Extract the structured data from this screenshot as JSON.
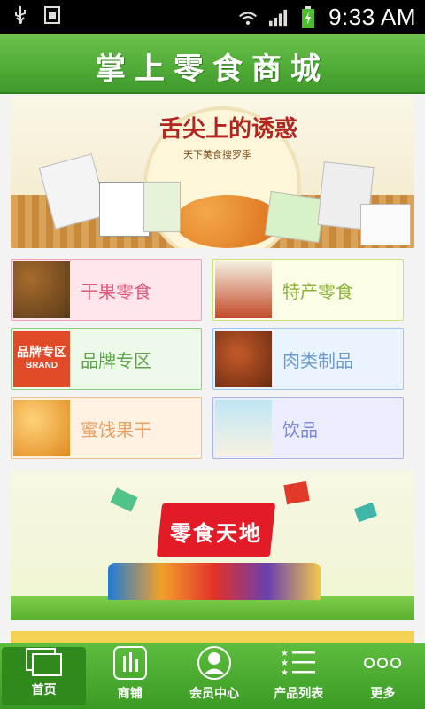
{
  "status_bar": {
    "time": "9:33 AM"
  },
  "header": {
    "title": "掌上零食商城"
  },
  "banner_top": {
    "headline": "舌尖上的诱惑",
    "subline": "天下美食搜罗季"
  },
  "categories": [
    {
      "label": "干果零食",
      "text_color": "#e05a7a",
      "bg": "#ffe6ec",
      "border": "#f2a0b5"
    },
    {
      "label": "特产零食",
      "text_color": "#8db33a",
      "bg": "#fbfde6",
      "border": "#cfe07a"
    },
    {
      "label": "品牌专区",
      "text_color": "#5da34a",
      "bg": "#eefae9",
      "border": "#8ccf7a"
    },
    {
      "label": "肉类制品",
      "text_color": "#6d9bcf",
      "bg": "#eaf4ff",
      "border": "#9ec6ee"
    },
    {
      "label": "蜜饯果干",
      "text_color": "#e8a060",
      "bg": "#fff2e3",
      "border": "#f0c18f"
    },
    {
      "label": "饮品",
      "text_color": "#7b86d6",
      "bg": "#eceeff",
      "border": "#aab2ee"
    }
  ],
  "brand_thumb_text": {
    "top": "品牌专区",
    "bottom": "BRAND"
  },
  "banner_bottom": {
    "headline": "零食天地"
  },
  "tabbar": {
    "items": [
      {
        "label": "首页",
        "icon": "home-window-icon"
      },
      {
        "label": "商铺",
        "icon": "shop-chart-icon"
      },
      {
        "label": "会员中心",
        "icon": "member-avatar-icon"
      },
      {
        "label": "产品列表",
        "icon": "product-list-icon"
      },
      {
        "label": "更多",
        "icon": "more-dots-icon"
      }
    ]
  },
  "colors": {
    "accent_green": "#4aa82f",
    "status_bar": "#000000"
  }
}
